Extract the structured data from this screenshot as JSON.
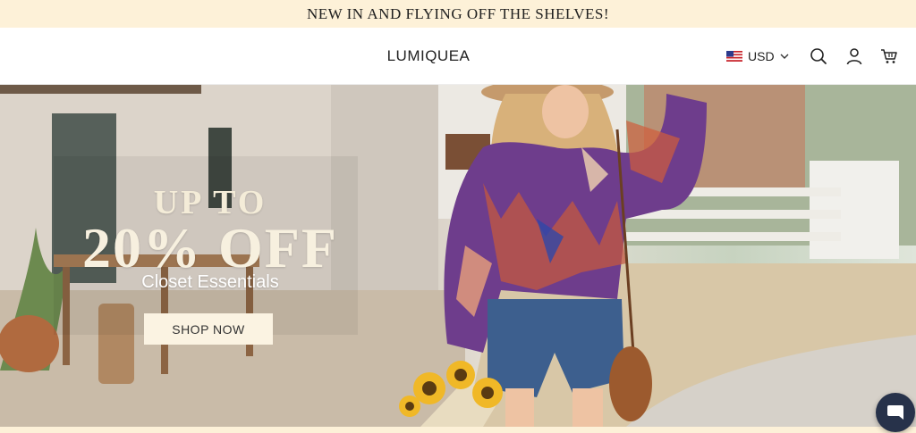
{
  "announcement": {
    "text": "NEW IN AND FLYING OFF THE SHELVES!"
  },
  "header": {
    "logo": "LUMIQUEA",
    "currency": {
      "code": "USD",
      "flag_icon": "us-flag-icon"
    },
    "icons": [
      "search-icon",
      "account-icon",
      "cart-icon"
    ]
  },
  "hero": {
    "promo_line1": "UP TO",
    "promo_line2": "20% OFF",
    "promo_line3": "Closet Essentials",
    "cta_label": "SHOP NOW"
  },
  "chat": {
    "icon": "chat-icon"
  },
  "colors": {
    "announcement_bg": "#fdf1d8",
    "promo_text": "#f4ecd8",
    "cta_bg": "#fbf3e2",
    "chat_bg": "#27324a"
  }
}
